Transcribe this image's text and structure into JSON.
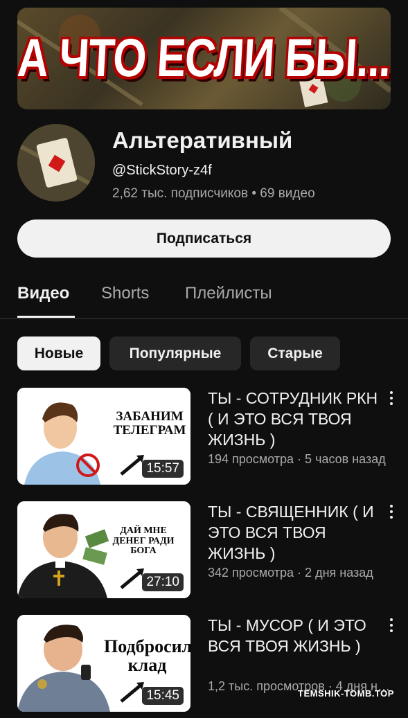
{
  "banner": {
    "title": "А ЧТО ЕСЛИ БЫ..."
  },
  "channel": {
    "name": "Альтеративный",
    "handle": "@StickStory-z4f",
    "stats": "2,62 тыс. подписчиков • 69 видео",
    "subscribe_label": "Подписаться"
  },
  "tabs": [
    {
      "label": "Видео",
      "active": true
    },
    {
      "label": "Shorts",
      "active": false
    },
    {
      "label": "Плейлисты",
      "active": false
    }
  ],
  "chips": [
    {
      "label": "Новые",
      "selected": true
    },
    {
      "label": "Популярные",
      "selected": false
    },
    {
      "label": "Старые",
      "selected": false
    }
  ],
  "videos": [
    {
      "title": "ТЫ - СОТРУДНИК РКН ( И ЭТО ВСЯ ТВОЯ ЖИЗНЬ )",
      "meta": "194 просмотра · 5 часов назад",
      "duration": "15:57",
      "thumb_caption": "ЗАБАНИМ ТЕЛЕГРАМ"
    },
    {
      "title": "ТЫ - СВЯЩЕННИК ( И ЭТО ВСЯ ТВОЯ ЖИЗНЬ )",
      "meta": "342 просмотра · 2 дня назад",
      "duration": "27:10",
      "thumb_caption": "ДАЙ МНЕ ДЕНЕГ РАДИ БОГА"
    },
    {
      "title": "ТЫ - МУСОР ( И ЭТО ВСЯ ТВОЯ ЖИЗНЬ )",
      "meta": "1,2 тыс. просмотров · 4 дня назад",
      "duration": "15:45",
      "thumb_caption": "Подбросил клад"
    }
  ],
  "watermark": "TEMSHIK-TOMB.TOP",
  "colors": {
    "background": "#0f0f0f",
    "accent_red": "#b30000",
    "muted": "#aaaaaa"
  }
}
